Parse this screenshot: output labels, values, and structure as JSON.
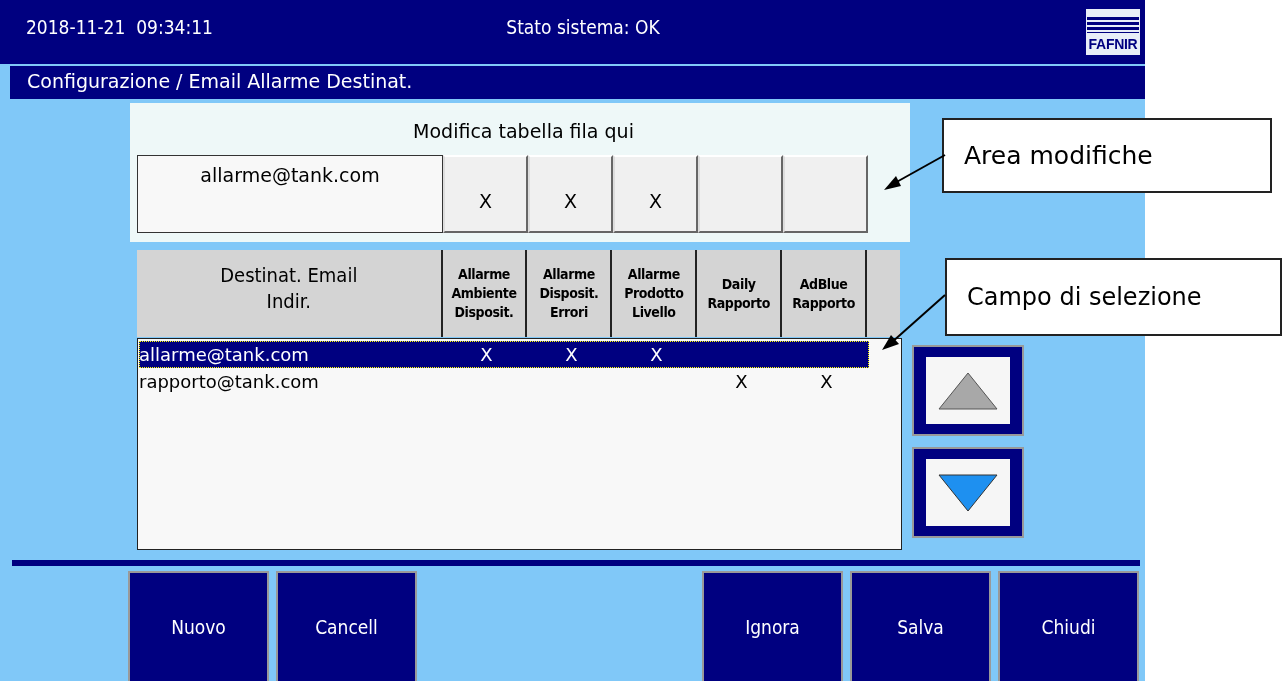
{
  "header": {
    "datetime": "2018-11-21  09:34:11",
    "status": "Stato sistema: OK",
    "logo": "FAFNIR"
  },
  "breadcrumb": "Configurazione / Email Allarme Destinat.",
  "edit_area": {
    "title": "Modifica tabella fila qui",
    "email": "allarme@tank.com",
    "cells": [
      {
        "value": "X"
      },
      {
        "value": "X"
      },
      {
        "value": "X"
      },
      {},
      {}
    ]
  },
  "table": {
    "columns": [
      "Destinat. Email\nIndir.",
      "Allarme\nAmbiente\nDisposit.",
      "Allarme\nDisposit.\nErrori",
      "Allarme\nProdotto\nLivello",
      "Daily\nRapporto",
      "AdBlue\nRapporto"
    ],
    "rows": [
      {
        "selected": true,
        "cells": [
          "allarme@tank.com",
          "X",
          "X",
          "X",
          "",
          ""
        ]
      },
      {
        "selected": false,
        "cells": [
          "rapporto@tank.com",
          "",
          "",
          "",
          "X",
          "X"
        ]
      }
    ]
  },
  "buttons_left": [
    "Nuovo",
    "Cancell"
  ],
  "buttons_right": [
    "Ignora",
    "Salva",
    "Chiudi"
  ],
  "annotations": [
    {
      "text": "Area modifiche"
    },
    {
      "text": "Campo di selezione"
    }
  ]
}
